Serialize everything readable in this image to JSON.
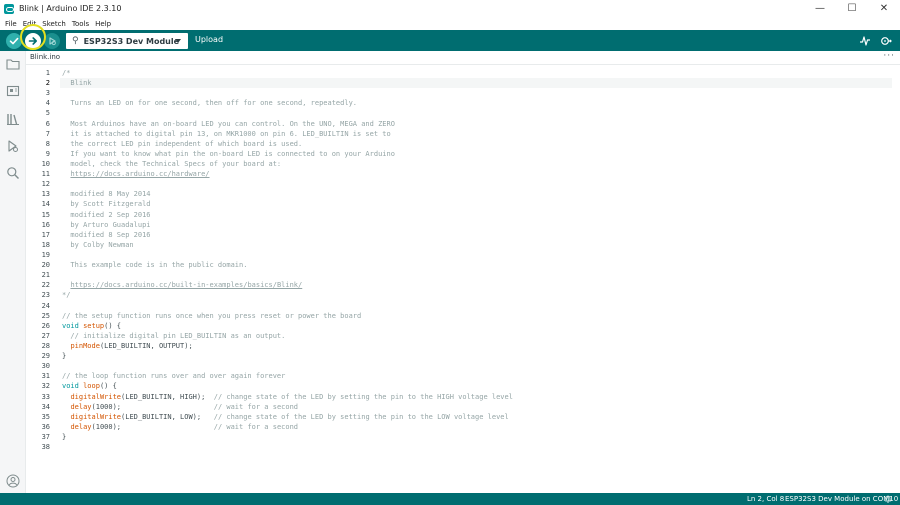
{
  "window": {
    "title": "Blink | Arduino IDE 2.3.10",
    "minimize_glyph": "—",
    "maximize_glyph": "☐",
    "close_glyph": "✕"
  },
  "menu": [
    "File",
    "Edit",
    "Sketch",
    "Tools",
    "Help"
  ],
  "toolbar": {
    "board": "ESP32S3 Dev Module",
    "upload_label": "Upload",
    "accent": "#006d70",
    "highlight": "#e3df1f"
  },
  "tab": {
    "file_name": "Blink.ino",
    "more_glyph": "···"
  },
  "editor": {
    "active_line": 2,
    "lines": [
      {
        "n": "1",
        "parts": [
          {
            "t": "/*",
            "c": "comment"
          }
        ]
      },
      {
        "n": "2",
        "parts": [
          {
            "t": "  Blink",
            "c": "comment"
          }
        ]
      },
      {
        "n": "3",
        "parts": []
      },
      {
        "n": "4",
        "parts": [
          {
            "t": "  Turns an LED on for one second, then off for one second, repeatedly.",
            "c": "comment"
          }
        ]
      },
      {
        "n": "5",
        "parts": []
      },
      {
        "n": "6",
        "parts": [
          {
            "t": "  Most Arduinos have an on-board LED you can control. On the UNO, MEGA and ZERO",
            "c": "comment"
          }
        ]
      },
      {
        "n": "7",
        "parts": [
          {
            "t": "  it is attached to digital pin 13, on MKR1000 on pin 6. LED_BUILTIN is set to",
            "c": "comment"
          }
        ]
      },
      {
        "n": "8",
        "parts": [
          {
            "t": "  the correct LED pin independent of which board is used.",
            "c": "comment"
          }
        ]
      },
      {
        "n": "9",
        "parts": [
          {
            "t": "  If you want to know what pin the on-board LED is connected to on your Arduino",
            "c": "comment"
          }
        ]
      },
      {
        "n": "10",
        "parts": [
          {
            "t": "  model, check the Technical Specs of your board at:",
            "c": "comment"
          }
        ]
      },
      {
        "n": "11",
        "parts": [
          {
            "t": "  ",
            "c": "comment"
          },
          {
            "t": "https://docs.arduino.cc/hardware/",
            "c": "url"
          }
        ]
      },
      {
        "n": "12",
        "parts": []
      },
      {
        "n": "13",
        "parts": [
          {
            "t": "  modified 8 May 2014",
            "c": "comment"
          }
        ]
      },
      {
        "n": "14",
        "parts": [
          {
            "t": "  by Scott Fitzgerald",
            "c": "comment"
          }
        ]
      },
      {
        "n": "15",
        "parts": [
          {
            "t": "  modified 2 Sep 2016",
            "c": "comment"
          }
        ]
      },
      {
        "n": "16",
        "parts": [
          {
            "t": "  by Arturo Guadalupi",
            "c": "comment"
          }
        ]
      },
      {
        "n": "17",
        "parts": [
          {
            "t": "  modified 8 Sep 2016",
            "c": "comment"
          }
        ]
      },
      {
        "n": "18",
        "parts": [
          {
            "t": "  by Colby Newman",
            "c": "comment"
          }
        ]
      },
      {
        "n": "19",
        "parts": []
      },
      {
        "n": "20",
        "parts": [
          {
            "t": "  This example code is in the public domain.",
            "c": "comment"
          }
        ]
      },
      {
        "n": "21",
        "parts": []
      },
      {
        "n": "22",
        "parts": [
          {
            "t": "  ",
            "c": "comment"
          },
          {
            "t": "https://docs.arduino.cc/built-in-examples/basics/Blink/",
            "c": "url"
          }
        ]
      },
      {
        "n": "23",
        "parts": [
          {
            "t": "*/",
            "c": "comment"
          }
        ]
      },
      {
        "n": "24",
        "parts": []
      },
      {
        "n": "25",
        "parts": [
          {
            "t": "// the setup function runs once when you press reset or power the board",
            "c": "comment"
          }
        ]
      },
      {
        "n": "26",
        "parts": [
          {
            "t": "void",
            "c": "kw"
          },
          {
            "t": " ",
            "c": ""
          },
          {
            "t": "setup",
            "c": "fn"
          },
          {
            "t": "() {",
            "c": ""
          }
        ]
      },
      {
        "n": "27",
        "parts": [
          {
            "t": "  // initialize digital pin LED_BUILTIN as an output.",
            "c": "comment"
          }
        ]
      },
      {
        "n": "28",
        "parts": [
          {
            "t": "  ",
            "c": ""
          },
          {
            "t": "pinMode",
            "c": "fn"
          },
          {
            "t": "(LED_BUILTIN, OUTPUT);",
            "c": ""
          }
        ]
      },
      {
        "n": "29",
        "parts": [
          {
            "t": "}",
            "c": ""
          }
        ]
      },
      {
        "n": "30",
        "parts": []
      },
      {
        "n": "31",
        "parts": [
          {
            "t": "// the loop function runs over and over again forever",
            "c": "comment"
          }
        ]
      },
      {
        "n": "32",
        "parts": [
          {
            "t": "void",
            "c": "kw"
          },
          {
            "t": " ",
            "c": ""
          },
          {
            "t": "loop",
            "c": "fn"
          },
          {
            "t": "() {",
            "c": ""
          }
        ]
      },
      {
        "n": "33",
        "parts": [
          {
            "t": "  ",
            "c": ""
          },
          {
            "t": "digitalWrite",
            "c": "fn"
          },
          {
            "t": "(LED_BUILTIN, HIGH);  ",
            "c": ""
          },
          {
            "t": "// change state of the LED by setting the pin to the HIGH voltage level",
            "c": "comment"
          }
        ]
      },
      {
        "n": "34",
        "parts": [
          {
            "t": "  ",
            "c": ""
          },
          {
            "t": "delay",
            "c": "fn"
          },
          {
            "t": "(1000);                      ",
            "c": ""
          },
          {
            "t": "// wait for a second",
            "c": "comment"
          }
        ]
      },
      {
        "n": "35",
        "parts": [
          {
            "t": "  ",
            "c": ""
          },
          {
            "t": "digitalWrite",
            "c": "fn"
          },
          {
            "t": "(LED_BUILTIN, LOW);   ",
            "c": ""
          },
          {
            "t": "// change state of the LED by setting the pin to the LOW voltage level",
            "c": "comment"
          }
        ]
      },
      {
        "n": "36",
        "parts": [
          {
            "t": "  ",
            "c": ""
          },
          {
            "t": "delay",
            "c": "fn"
          },
          {
            "t": "(1000);                      ",
            "c": ""
          },
          {
            "t": "// wait for a second",
            "c": "comment"
          }
        ]
      },
      {
        "n": "37",
        "parts": [
          {
            "t": "}",
            "c": ""
          }
        ]
      },
      {
        "n": "38",
        "parts": []
      }
    ]
  },
  "status": {
    "position": "Ln 2, Col 8",
    "board_port": "ESP32S3 Dev Module on COM10"
  },
  "icons": {
    "verify": "checkmark-icon",
    "upload": "arrow-right-icon",
    "debug": "debug-icon",
    "plotter": "serial-plotter-icon",
    "monitor": "serial-monitor-icon",
    "sidebar": [
      "folder-icon",
      "board-manager-icon",
      "library-icon",
      "debug-panel-icon",
      "search-icon",
      "account-icon"
    ],
    "bell": "bell-icon"
  }
}
